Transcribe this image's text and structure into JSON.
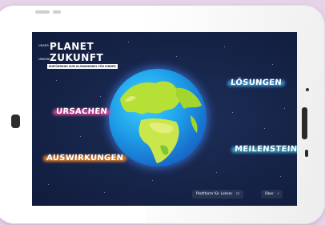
{
  "logo": {
    "prefix_top": "UNSER",
    "title_line1": "PLANET",
    "prefix_bottom": "UNSERE",
    "title_line2": "ZUKUNFT",
    "banner": "EINFÜHRUNG ZUM KLIMAWANDEL FÜR KINDER"
  },
  "categories": {
    "causes": "URSACHEN",
    "solutions": "LÖSUNGEN",
    "effects": "AUSWIRKUNGEN",
    "milestones": "MEILENSTEINE"
  },
  "footer": {
    "platform_label": "Plattform für Lehrer",
    "platform_icon": "monitor-icon",
    "about_label": "Über",
    "about_icon": "chevron-right-icon"
  },
  "colors": {
    "causes": "#e0489a",
    "solutions": "#3d9bd9",
    "effects": "#f08a2a",
    "milestones": "#3aa7c9",
    "background": "#162449"
  }
}
